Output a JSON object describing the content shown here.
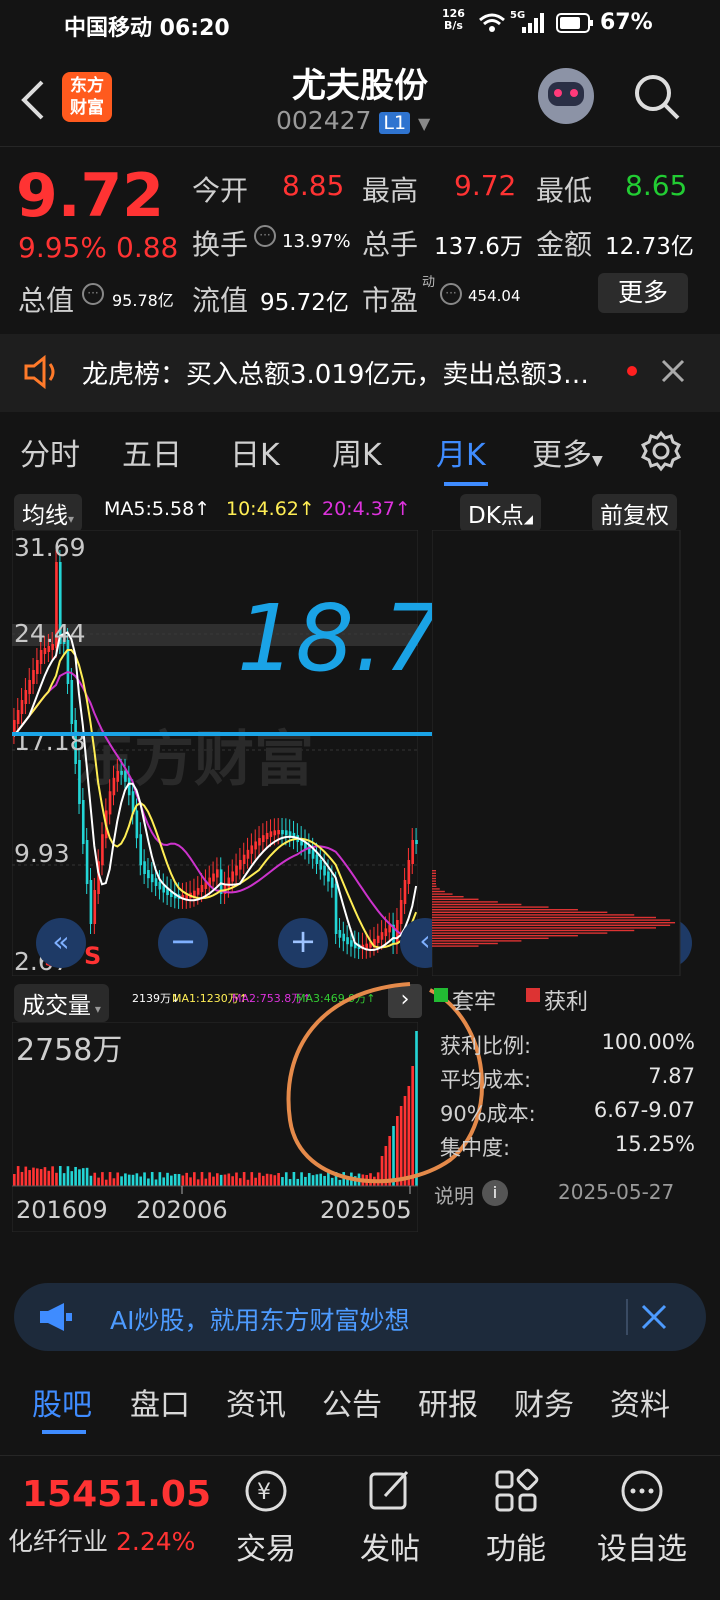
{
  "status": {
    "carrier_time": "中国移动 06:20",
    "net_speed_top": "126",
    "net_speed_unit": "B/s",
    "signal": "5G",
    "battery": "67%"
  },
  "header": {
    "logo_text_1": "东方",
    "logo_text_2": "财富",
    "stock_name": "尤夫股份",
    "stock_code": "002427",
    "level_badge": "L1"
  },
  "quote": {
    "price": "9.72",
    "change_pct": "9.95%",
    "change": "0.88",
    "open_label": "今开",
    "open": "8.85",
    "high_label": "最高",
    "high": "9.72",
    "low_label": "最低",
    "low": "8.65",
    "turnover_label": "换手",
    "turnover": "13.97%",
    "volume_label": "总手",
    "volume": "137.6万",
    "amount_label": "金额",
    "amount": "12.73亿",
    "mktcap_label": "总值",
    "mktcap": "95.78亿",
    "float_label": "流值",
    "float": "95.72亿",
    "pe_label": "市盈",
    "pe_sup": "动",
    "pe": "454.04",
    "more_button": "更多"
  },
  "notice": {
    "text": "龙虎榜：买入总额3.019亿元，卖出总额3…"
  },
  "tabs": [
    "分时",
    "五日",
    "日K",
    "周K",
    "月K",
    "更多"
  ],
  "chart": {
    "indicator_button": "均线",
    "ma5": "MA5:5.58",
    "ma10": "10:4.62",
    "ma20": "20:4.37",
    "dk_button": "DK点",
    "adjust_button": "前复权",
    "y_labels": [
      "31.69",
      "24.44",
      "17.18",
      "9.93",
      "2.67"
    ],
    "buy_sell_marks": [
      "S",
      "S",
      "S"
    ],
    "annotation_text": "18.7",
    "volume_button": "成交量",
    "vol_legend": {
      "v": "2139万",
      "ma1": "MA1:1230万",
      "ma2": "MA2:753.8万",
      "ma3": "MA3:469.9万"
    },
    "vol_max": "2758万",
    "x_labels": [
      "201609",
      "202006",
      "202505"
    ],
    "colors": {
      "up": "#ff3333",
      "down": "#23d5d5",
      "ma5": "#ffffff",
      "ma10": "#ffee55",
      "ma20": "#cc33cc",
      "annotation": "#1aa3e6",
      "circle": "#e58a4a"
    }
  },
  "chip_panel": {
    "legend_trapped": "套牢",
    "legend_profit": "获利",
    "rows": [
      {
        "k": "获利比例:",
        "v": "100.00%"
      },
      {
        "k": "平均成本:",
        "v": "7.87"
      },
      {
        "k": "90%成本:",
        "v": "6.67-9.07"
      },
      {
        "k": "集中度:",
        "v": "15.25%"
      }
    ],
    "note_label": "说明",
    "date": "2025-05-27"
  },
  "ai_banner": {
    "text": "AI炒股，就用东方财富妙想"
  },
  "bottom_tabs": [
    "股吧",
    "盘口",
    "资讯",
    "公告",
    "研报",
    "财务",
    "资料"
  ],
  "bottom_nav": {
    "index_value": "15451.05",
    "index_name": "化纤行业",
    "index_pct": "2.24%",
    "items": [
      "交易",
      "发帖",
      "功能",
      "设自选"
    ]
  }
}
